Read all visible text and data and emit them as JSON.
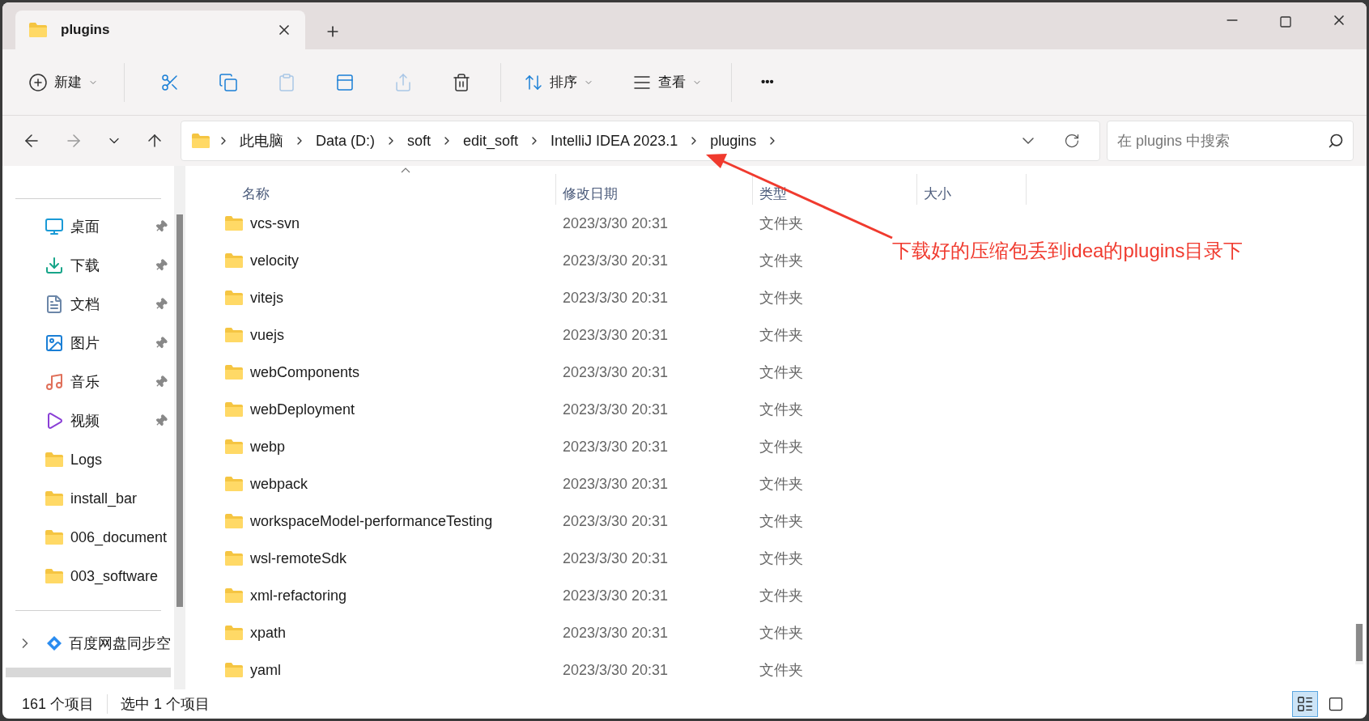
{
  "tabs": [
    {
      "label": "plugins",
      "selected": true
    }
  ],
  "toolbar": {
    "new_label": "新建",
    "sort_label": "排序",
    "view_label": "查看",
    "more_label": "•••"
  },
  "address": {
    "crumbs": [
      "此电脑",
      "Data (D:)",
      "soft",
      "edit_soft",
      "IntelliJ IDEA 2023.1",
      "plugins"
    ]
  },
  "search": {
    "placeholder": "在 plugins 中搜索"
  },
  "sidebar": {
    "items": [
      {
        "label": "桌面",
        "kind": "desktop",
        "pinned": true
      },
      {
        "label": "下载",
        "kind": "download",
        "pinned": true
      },
      {
        "label": "文档",
        "kind": "document",
        "pinned": true
      },
      {
        "label": "图片",
        "kind": "pictures",
        "pinned": true
      },
      {
        "label": "音乐",
        "kind": "music",
        "pinned": true
      },
      {
        "label": "视频",
        "kind": "video",
        "pinned": true
      },
      {
        "label": "Logs",
        "kind": "folder",
        "pinned": false
      },
      {
        "label": "install_bar",
        "kind": "folder",
        "pinned": false
      },
      {
        "label": "006_document",
        "kind": "folder",
        "pinned": false
      },
      {
        "label": "003_software",
        "kind": "folder",
        "pinned": false
      }
    ],
    "cloud": {
      "label": "百度网盘同步空",
      "expanded": false
    }
  },
  "table": {
    "columns": [
      "名称",
      "修改日期",
      "类型",
      "大小"
    ],
    "rows": [
      {
        "name": "vcs-svn",
        "date": "2023/3/30 20:31",
        "type": "文件夹"
      },
      {
        "name": "velocity",
        "date": "2023/3/30 20:31",
        "type": "文件夹"
      },
      {
        "name": "vitejs",
        "date": "2023/3/30 20:31",
        "type": "文件夹"
      },
      {
        "name": "vuejs",
        "date": "2023/3/30 20:31",
        "type": "文件夹"
      },
      {
        "name": "webComponents",
        "date": "2023/3/30 20:31",
        "type": "文件夹"
      },
      {
        "name": "webDeployment",
        "date": "2023/3/30 20:31",
        "type": "文件夹"
      },
      {
        "name": "webp",
        "date": "2023/3/30 20:31",
        "type": "文件夹"
      },
      {
        "name": "webpack",
        "date": "2023/3/30 20:31",
        "type": "文件夹"
      },
      {
        "name": "workspaceModel-performanceTesting",
        "date": "2023/3/30 20:31",
        "type": "文件夹"
      },
      {
        "name": "wsl-remoteSdk",
        "date": "2023/3/30 20:31",
        "type": "文件夹"
      },
      {
        "name": "xml-refactoring",
        "date": "2023/3/30 20:31",
        "type": "文件夹"
      },
      {
        "name": "xpath",
        "date": "2023/3/30 20:31",
        "type": "文件夹"
      },
      {
        "name": "yaml",
        "date": "2023/3/30 20:31",
        "type": "文件夹"
      }
    ]
  },
  "annotation": {
    "text": "下载好的压缩包丢到idea的plugins目录下"
  },
  "status_bar": {
    "count": "161 个项目",
    "selection": "选中 1 个项目"
  }
}
